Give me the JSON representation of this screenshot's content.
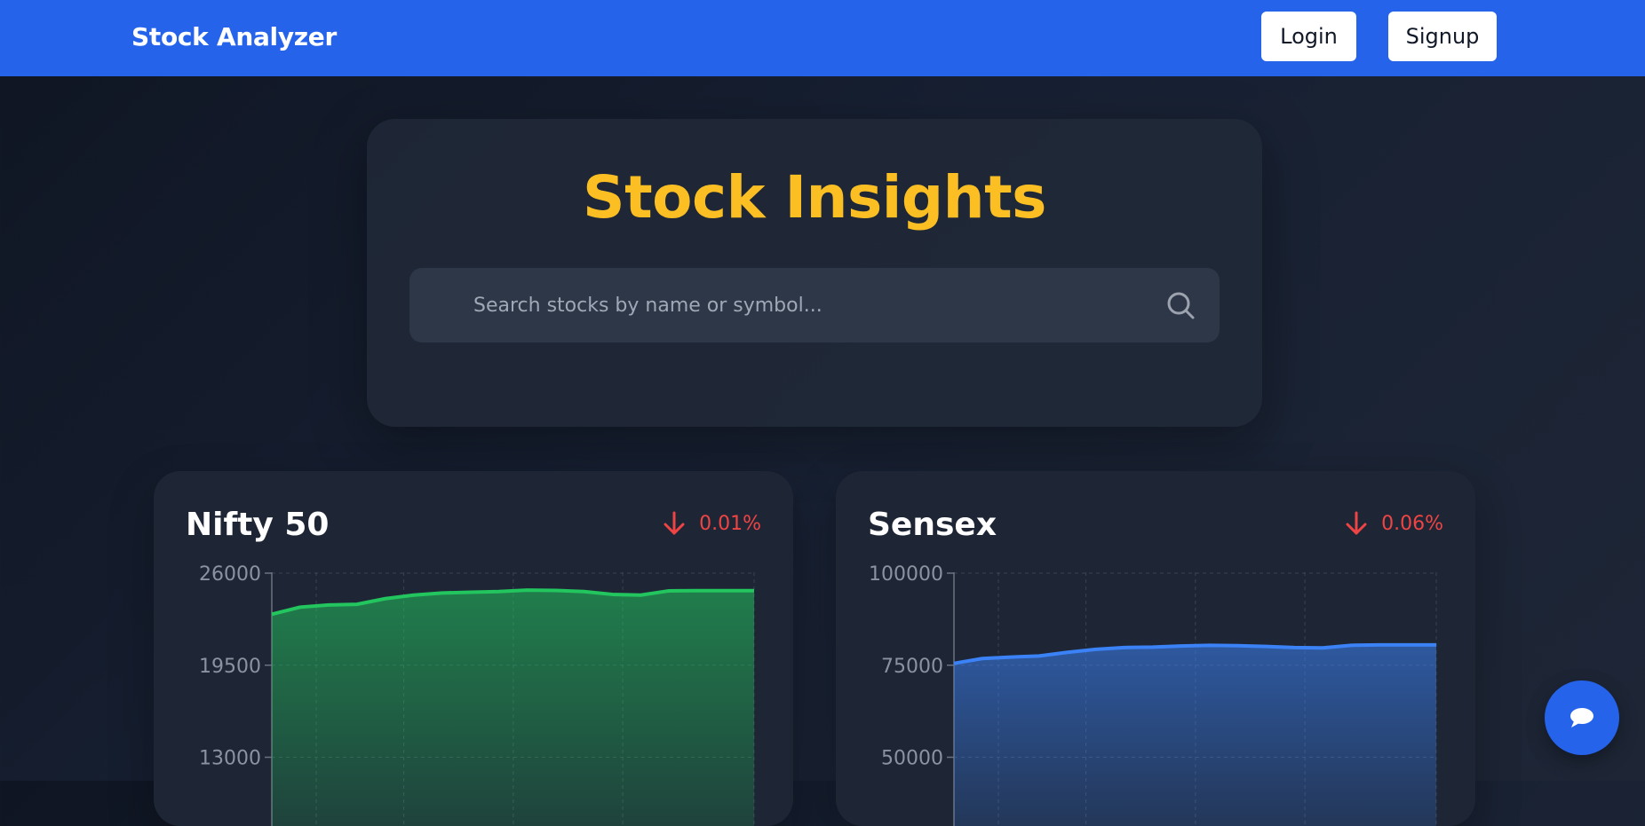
{
  "navbar": {
    "brand": "Stock Analyzer",
    "login_label": "Login",
    "signup_label": "Signup"
  },
  "hero": {
    "title": "Stock Insights",
    "search_placeholder": "Search stocks by name or symbol..."
  },
  "colors": {
    "navbar": "#2563eb",
    "title_accent": "#fbbf24",
    "negative": "#ef4444",
    "nifty_line": "#22c55e",
    "sensex_line": "#3b82f6"
  },
  "icons": {
    "search": "search-icon",
    "down_arrow": "arrow-down-icon",
    "chat": "chat-bubble-icon"
  },
  "chart_data": [
    {
      "type": "area",
      "title": "Nifty 50",
      "change": "0.01%",
      "direction": "down",
      "ylim": [
        0,
        26000
      ],
      "yticks": [
        "26000",
        "19500",
        "13000"
      ],
      "grid": true,
      "color": "#22c55e",
      "values": [
        23100,
        23600,
        23750,
        23800,
        24200,
        24450,
        24600,
        24650,
        24700,
        24800,
        24780,
        24700,
        24500,
        24450,
        24750,
        24760,
        24760,
        24760
      ]
    },
    {
      "type": "area",
      "title": "Sensex",
      "change": "0.06%",
      "direction": "down",
      "ylim": [
        0,
        100000
      ],
      "yticks": [
        "100000",
        "75000",
        "50000"
      ],
      "grid": true,
      "color": "#3b82f6",
      "values": [
        75500,
        76800,
        77200,
        77500,
        78500,
        79300,
        79800,
        79900,
        80200,
        80400,
        80300,
        80100,
        79800,
        79700,
        80400,
        80500,
        80500,
        80500
      ]
    }
  ]
}
